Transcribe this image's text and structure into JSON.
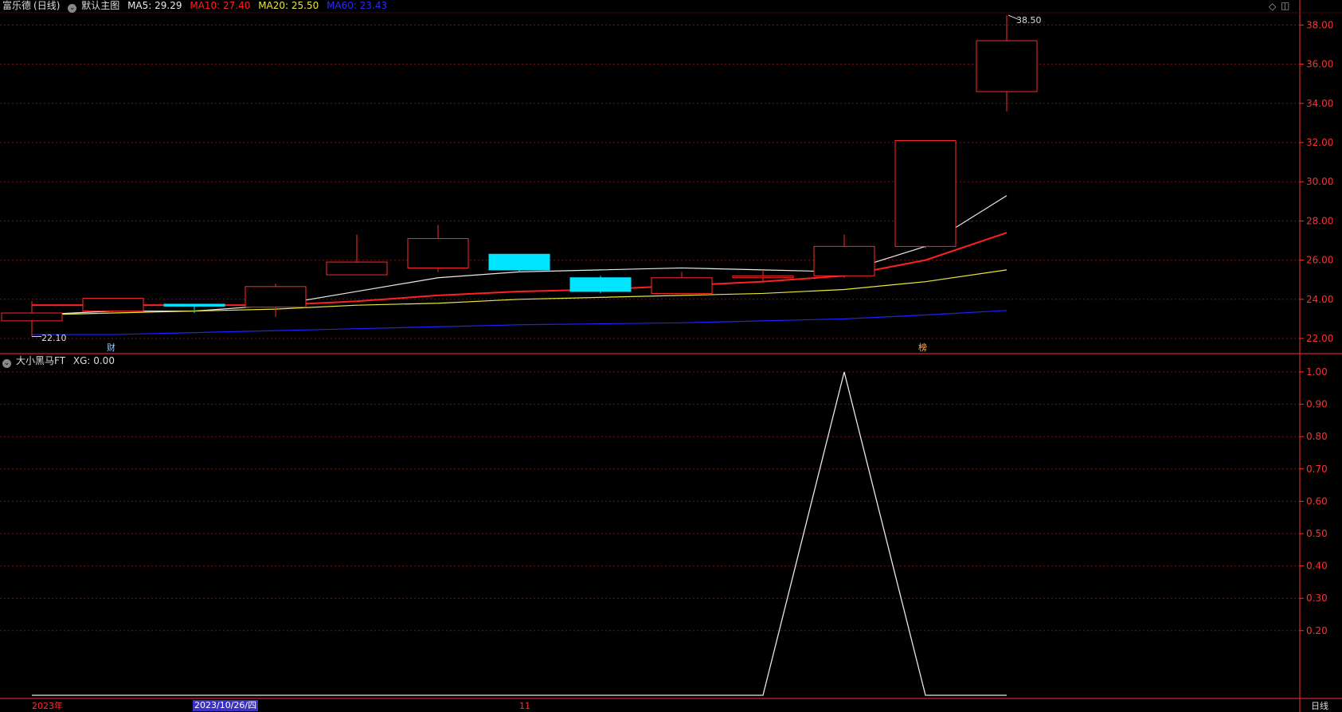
{
  "main_header": {
    "stock_name": "富乐德",
    "period": "(日线)",
    "template": "默认主图",
    "ma5": "MA5: 29.29",
    "ma10": "MA10: 27.40",
    "ma20": "MA20: 25.50",
    "ma60": "MA60: 23.43"
  },
  "sub_header": {
    "indicator": "大小黑马FT",
    "xg": "XG: 0.00"
  },
  "footer": {
    "year_label": "2023年",
    "cursor_date": "2023/10/26/四",
    "month_label": "11",
    "period_tab": "日线"
  },
  "markers": {
    "cai": "财",
    "bang": "榜",
    "high_label": "38.50",
    "low_label": "22.10"
  },
  "colors": {
    "up": "#ff2a2a",
    "down": "#00e5ff",
    "ma5": "#e8e8e8",
    "ma10": "#ff2020",
    "ma20": "#e8e83a",
    "ma60": "#2020ff",
    "grid": "#7a1515",
    "axis_text": "#ff3030"
  },
  "chart_data": [
    {
      "type": "candlestick",
      "y_ticks": [
        "38.00",
        "36.00",
        "34.00",
        "32.00",
        "30.00",
        "28.00",
        "26.00",
        "24.00",
        "22.00"
      ],
      "ylim": [
        21.4,
        38.9
      ],
      "candles": [
        {
          "open": 23.3,
          "close": 22.9,
          "high": 23.9,
          "low": 22.1,
          "dir": "up"
        },
        {
          "open": 23.4,
          "close": 24.05,
          "high": 24.05,
          "low": 23.3,
          "dir": "up"
        },
        {
          "open": 23.75,
          "close": 23.65,
          "high": 23.75,
          "low": 23.3,
          "dir": "down"
        },
        {
          "open": 23.6,
          "close": 24.65,
          "high": 24.8,
          "low": 23.1,
          "dir": "up"
        },
        {
          "open": 25.25,
          "close": 25.9,
          "high": 27.3,
          "low": 25.25,
          "dir": "up"
        },
        {
          "open": 25.6,
          "close": 27.1,
          "high": 27.8,
          "low": 25.4,
          "dir": "up"
        },
        {
          "open": 26.3,
          "close": 25.5,
          "high": 26.3,
          "low": 25.4,
          "dir": "down"
        },
        {
          "open": 25.1,
          "close": 24.4,
          "high": 25.2,
          "low": 24.3,
          "dir": "down"
        },
        {
          "open": 24.3,
          "close": 25.1,
          "high": 25.4,
          "low": 24.3,
          "dir": "up"
        },
        {
          "open": 25.2,
          "close": 25.1,
          "high": 25.5,
          "low": 24.9,
          "dir": "up"
        },
        {
          "open": 25.2,
          "close": 26.7,
          "high": 27.3,
          "low": 25.1,
          "dir": "up"
        },
        {
          "open": 26.7,
          "close": 32.1,
          "high": 32.1,
          "low": 26.6,
          "dir": "up"
        },
        {
          "open": 34.6,
          "close": 37.2,
          "high": 38.5,
          "low": 33.6,
          "dir": "up"
        }
      ],
      "ma_series": [
        {
          "name": "MA5",
          "values": [
            23.2,
            23.4,
            23.4,
            23.7,
            24.4,
            25.1,
            25.4,
            25.5,
            25.6,
            25.5,
            25.4,
            26.7,
            29.29
          ]
        },
        {
          "name": "MA10",
          "values": [
            23.7,
            23.7,
            23.7,
            23.7,
            23.9,
            24.2,
            24.4,
            24.5,
            24.7,
            24.9,
            25.2,
            26.0,
            27.4
          ]
        },
        {
          "name": "MA20",
          "values": [
            23.2,
            23.3,
            23.4,
            23.5,
            23.7,
            23.8,
            24.0,
            24.1,
            24.2,
            24.3,
            24.5,
            24.9,
            25.5
          ]
        },
        {
          "name": "MA60",
          "values": [
            22.2,
            22.2,
            22.3,
            22.4,
            22.5,
            22.6,
            22.7,
            22.75,
            22.8,
            22.9,
            23.0,
            23.2,
            23.43
          ]
        }
      ]
    },
    {
      "type": "line",
      "y_ticks": [
        "1.00",
        "0.90",
        "0.80",
        "0.70",
        "0.60",
        "0.50",
        "0.40",
        "0.30",
        "0.20"
      ],
      "ylim": [
        0,
        1
      ],
      "values": [
        0,
        0,
        0,
        0,
        0,
        0,
        0,
        0,
        0,
        0,
        1,
        0,
        0
      ]
    }
  ]
}
